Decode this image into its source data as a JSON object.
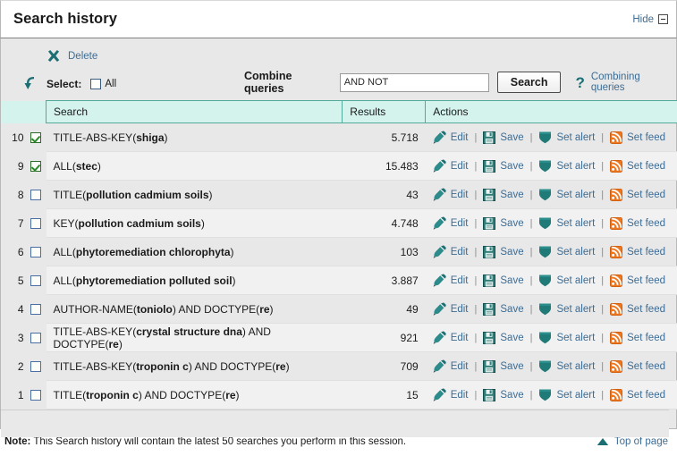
{
  "header": {
    "title": "Search history",
    "hide_label": "Hide",
    "hide_icon": "minus-box-icon"
  },
  "toolbar": {
    "delete_label": "Delete",
    "delete_icon": "x-icon",
    "select_icon": "curved-arrow-icon",
    "select_label": "Select:",
    "all_label": "All",
    "combine_label": "Combine queries",
    "combine_value": "AND NOT",
    "combine_placeholder": "",
    "search_button": "Search",
    "help_icon": "question-mark-icon",
    "help_label": "Combining queries"
  },
  "table": {
    "columns": {
      "search": "Search",
      "results": "Results",
      "actions": "Actions"
    },
    "actions": {
      "edit": "Edit",
      "save": "Save",
      "set_alert": "Set alert",
      "set_feed": "Set feed",
      "separator": "|"
    },
    "rows": [
      {
        "num": "10",
        "checked": true,
        "field": "TITLE-ABS-KEY",
        "term": "shiga",
        "suffix": "",
        "query": "TITLE-ABS-KEY(shiga)",
        "results": "5.718"
      },
      {
        "num": "9",
        "checked": true,
        "field": "ALL",
        "term": "stec",
        "suffix": "",
        "query": "ALL(stec)",
        "results": "15.483"
      },
      {
        "num": "8",
        "checked": false,
        "field": "TITLE",
        "term": "pollution cadmium soils",
        "suffix": "",
        "query": "TITLE(pollution cadmium soils)",
        "results": "43"
      },
      {
        "num": "7",
        "checked": false,
        "field": "KEY",
        "term": "pollution cadmium soils",
        "suffix": "",
        "query": "KEY(pollution cadmium soils)",
        "results": "4.748"
      },
      {
        "num": "6",
        "checked": false,
        "field": "ALL",
        "term": "phytoremediation chlorophyta",
        "suffix": "",
        "query": "ALL(phytoremediation chlorophyta)",
        "results": "103"
      },
      {
        "num": "5",
        "checked": false,
        "field": "ALL",
        "term": "phytoremediation polluted soil",
        "suffix": "",
        "query": "ALL(phytoremediation polluted soil)",
        "results": "3.887"
      },
      {
        "num": "4",
        "checked": false,
        "field": "AUTHOR-NAME",
        "term": "toniolo",
        "suffix": " AND DOCTYPE(re)",
        "query": "AUTHOR-NAME(toniolo) AND DOCTYPE(re)",
        "results": "49"
      },
      {
        "num": "3",
        "checked": false,
        "field": "TITLE-ABS-KEY",
        "term": "crystal structure dna",
        "suffix": " AND DOCTYPE(re)",
        "query": "TITLE-ABS-KEY(crystal structure dna) AND DOCTYPE(re)",
        "results": "921"
      },
      {
        "num": "2",
        "checked": false,
        "field": "TITLE-ABS-KEY",
        "term": "troponin c",
        "suffix": " AND DOCTYPE(re)",
        "query": "TITLE-ABS-KEY(troponin c) AND DOCTYPE(re)",
        "results": "709"
      },
      {
        "num": "1",
        "checked": false,
        "field": "TITLE",
        "term": "troponin c",
        "suffix": " AND DOCTYPE(re)",
        "query": "TITLE(troponin c) AND DOCTYPE(re)",
        "results": "15"
      }
    ]
  },
  "footer": {
    "note_prefix": "Note:",
    "note_text": " This Search history will contain the latest 50 searches you perform in this session.",
    "top_of_page": "Top of page",
    "top_icon": "up-triangle-icon"
  },
  "colors": {
    "teal": "#1b6f74",
    "link": "#3d6c94",
    "header_bg": "#d3f3ec",
    "panel_bg": "#e8e8e8",
    "rss_orange": "#f0761e",
    "check_green": "#2a8a2a"
  }
}
